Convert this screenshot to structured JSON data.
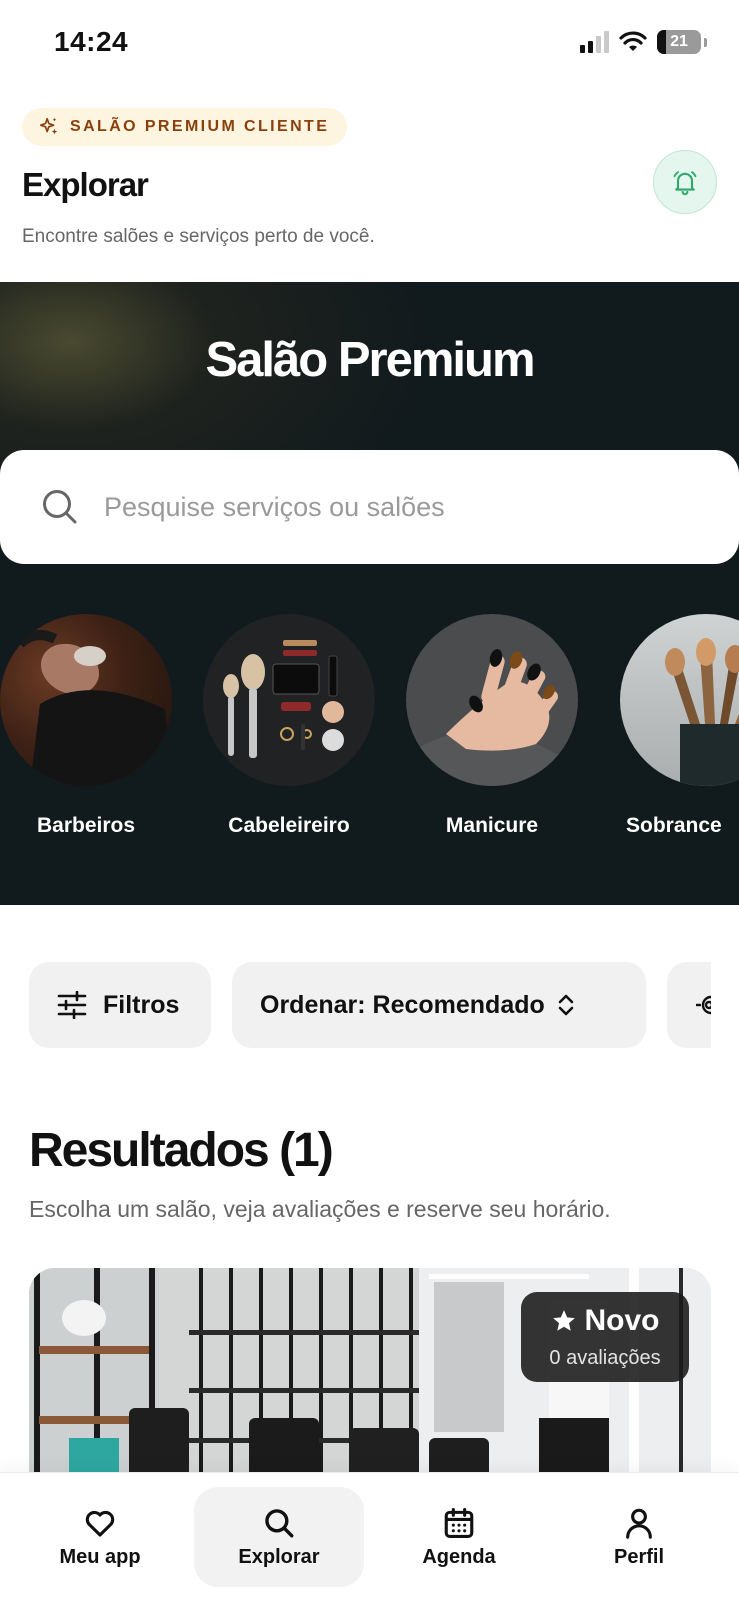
{
  "status_bar": {
    "time": "14:24",
    "battery": "21"
  },
  "header": {
    "badge_label": "SALÃO PREMIUM CLIENTE",
    "title": "Explorar",
    "subtitle": "Encontre salões e serviços perto de você."
  },
  "hero": {
    "brand_title": "Salão Premium",
    "search_placeholder": "Pesquise serviços ou salões",
    "categories": [
      {
        "label": "Barbeiros"
      },
      {
        "label": "Cabeleireiro"
      },
      {
        "label": "Manicure"
      },
      {
        "label": "Sobrance"
      }
    ]
  },
  "filters": {
    "filter_label": "Filtros",
    "sort_label": "Ordenar: Recomendado"
  },
  "results": {
    "title": "Resultados (1)",
    "subtitle": "Escolha um salão, veja avaliações e reserve seu horário.",
    "items": [
      {
        "rating_label": "Novo",
        "reviews_label": "0 avaliações"
      }
    ]
  },
  "bottom_nav": {
    "items": [
      {
        "label": "Meu app",
        "icon": "heart-icon"
      },
      {
        "label": "Explorar",
        "icon": "search-icon",
        "active": true
      },
      {
        "label": "Agenda",
        "icon": "calendar-icon"
      },
      {
        "label": "Perfil",
        "icon": "user-icon"
      }
    ]
  },
  "colors": {
    "badge_bg": "#fdf5df",
    "badge_text": "#8a3f0d",
    "bell_accent": "#2fa86f",
    "hero_bg": "#111a1d"
  }
}
